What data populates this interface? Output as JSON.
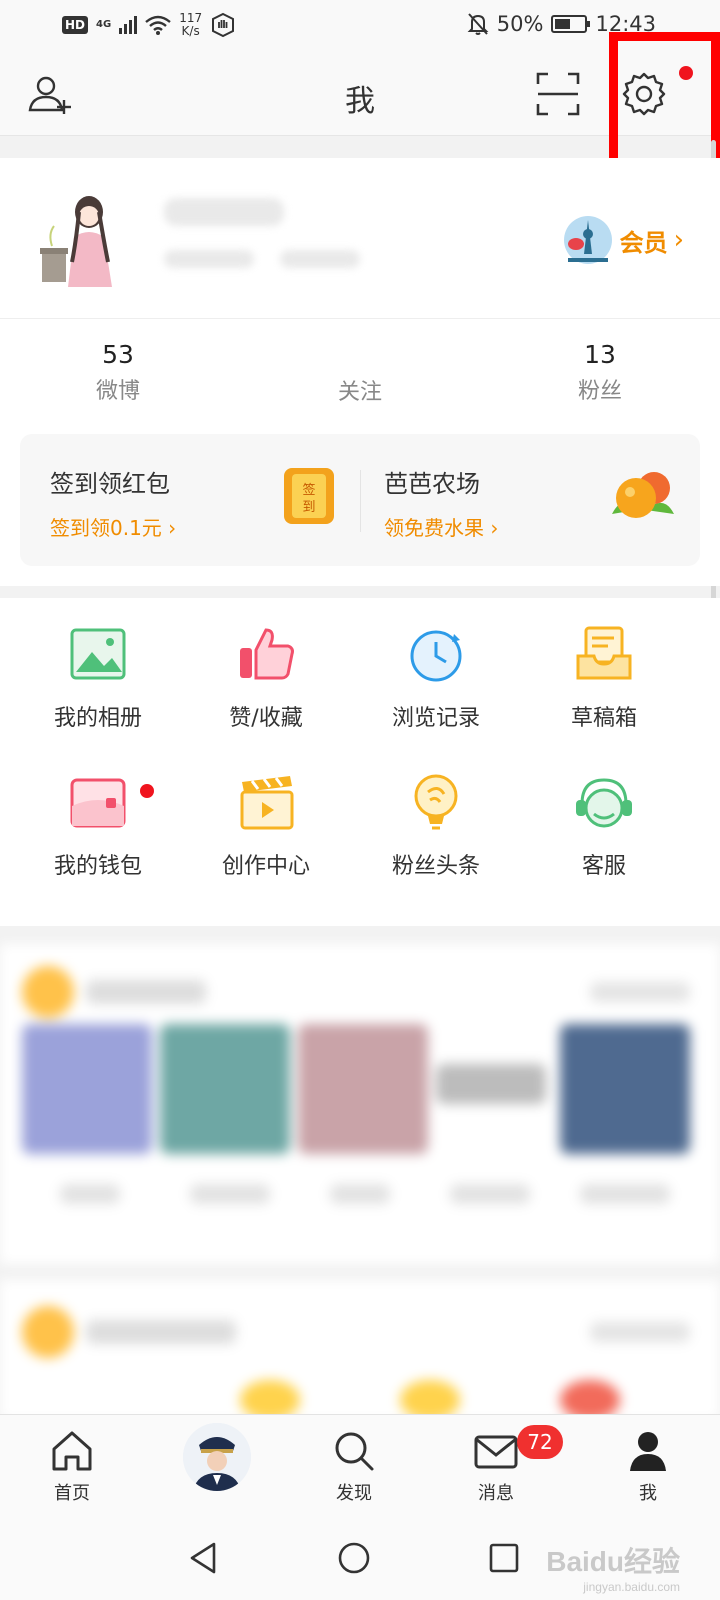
{
  "status_bar": {
    "hd": "HD",
    "network": "4G",
    "speed_value": "117",
    "speed_unit": "K/s",
    "battery": "50%",
    "battery_level": 0.5,
    "time": "12:43"
  },
  "header": {
    "title": "我",
    "icons": [
      "add-friend-icon",
      "scan-icon",
      "gear-icon"
    ],
    "settings_has_notification": true
  },
  "profile": {
    "vip_label": "会员",
    "vip_arrow": "›",
    "stats": [
      {
        "value": "53",
        "label": "微博"
      },
      {
        "value": "",
        "label": "关注"
      },
      {
        "value": "13",
        "label": "粉丝"
      }
    ]
  },
  "promo": {
    "left": {
      "title": "签到领红包",
      "subtitle": "签到领0.1元 ›",
      "icon_text": "签到"
    },
    "right": {
      "title": "芭芭农场",
      "subtitle": "领免费水果 ›"
    }
  },
  "grid": [
    {
      "label": "我的相册",
      "icon": "album-icon"
    },
    {
      "label": "赞/收藏",
      "icon": "thumbs-up-icon"
    },
    {
      "label": "浏览记录",
      "icon": "history-clock-icon"
    },
    {
      "label": "草稿箱",
      "icon": "drafts-icon"
    },
    {
      "label": "我的钱包",
      "icon": "wallet-icon"
    },
    {
      "label": "创作中心",
      "icon": "creator-clapper-icon"
    },
    {
      "label": "粉丝头条",
      "icon": "fan-headline-icon"
    },
    {
      "label": "客服",
      "icon": "customer-service-icon"
    }
  ],
  "tabbar": {
    "tabs": [
      {
        "label": "首页",
        "icon": "home-icon"
      },
      {
        "label": "",
        "icon": "avatar"
      },
      {
        "label": "发现",
        "icon": "search-icon"
      },
      {
        "label": "消息",
        "icon": "mail-icon"
      },
      {
        "label": "我",
        "icon": "person-icon"
      }
    ],
    "message_badge": "72"
  },
  "watermark": {
    "brand": "Baidu经验",
    "url": "jingyan.baidu.com"
  },
  "colors": {
    "accent": "#f08c00",
    "alert": "#f0141e",
    "highlight": "#ff0000"
  }
}
